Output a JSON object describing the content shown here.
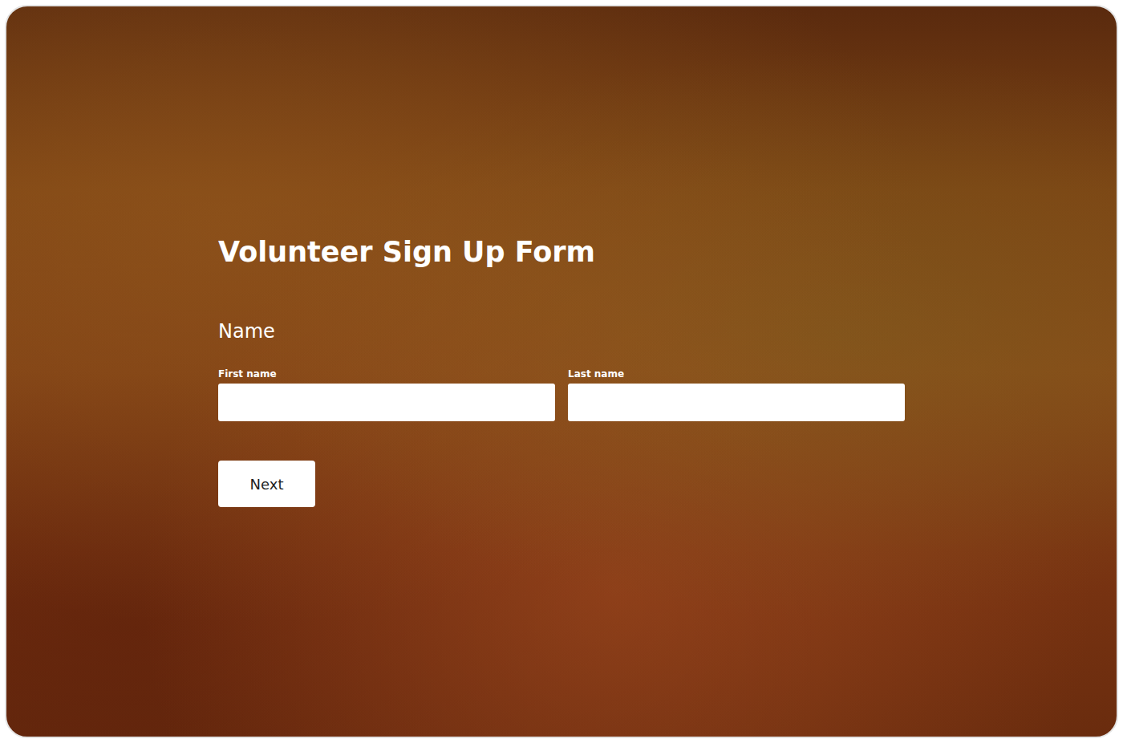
{
  "title": "Volunteer Sign Up Form",
  "question": {
    "label": "Name",
    "fields": [
      {
        "label": "First name",
        "value": ""
      },
      {
        "label": "Last name",
        "value": ""
      }
    ]
  },
  "buttons": [
    "Next"
  ]
}
